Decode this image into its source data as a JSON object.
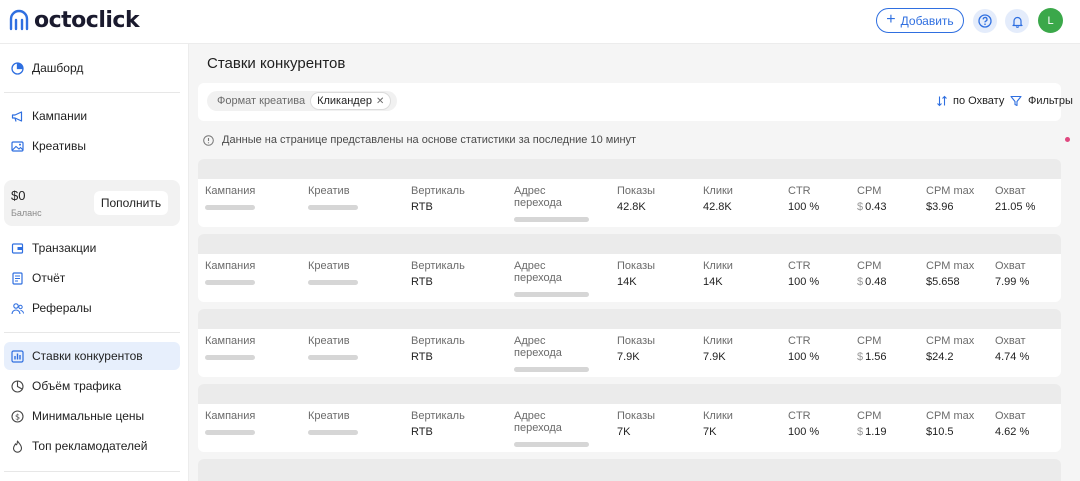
{
  "app": {
    "logo_text": "octoclick"
  },
  "header": {
    "add_label": "Добавить",
    "avatar_letter": "L"
  },
  "sidebar": {
    "dashboard": "Дашборд",
    "campaigns": "Кампании",
    "creatives": "Креативы",
    "balance_amount": "$0",
    "balance_label": "Баланс",
    "topup_label": "Пополнить",
    "transactions": "Транзакции",
    "report": "Отчёт",
    "referrals": "Рефералы",
    "competitor_bids": "Ставки конкурентов",
    "traffic_volume": "Объём трафика",
    "min_prices": "Минимальные цены",
    "top_advertisers": "Топ рекламодателей"
  },
  "main": {
    "title": "Ставки конкурентов",
    "filter_chip_label": "Формат креатива",
    "filter_chip_value": "Кликандер",
    "sort_label": "по Охвату",
    "filters_label": "Фильтры",
    "info_text": "Данные на странице представлены на основе статистики за последние 10 минут"
  },
  "columns": {
    "campaign": "Кампания",
    "creative": "Креатив",
    "vertical": "Вертикаль",
    "url": "Адрес перехода",
    "impressions": "Показы",
    "clicks": "Клики",
    "ctr": "CTR",
    "cpm": "CPM",
    "cpm_max": "CPM max",
    "reach": "Охват"
  },
  "rows": [
    {
      "vertical": "RTB",
      "impressions": "42.8K",
      "clicks": "42.8K",
      "ctr": "100 %",
      "cpm_currency": "$",
      "cpm": "0.43",
      "cpm_max": "$3.96",
      "reach": "21.05 %"
    },
    {
      "vertical": "RTB",
      "impressions": "14K",
      "clicks": "14K",
      "ctr": "100 %",
      "cpm_currency": "$",
      "cpm": "0.48",
      "cpm_max": "$5.658",
      "reach": "7.99 %"
    },
    {
      "vertical": "RTB",
      "impressions": "7.9K",
      "clicks": "7.9K",
      "ctr": "100 %",
      "cpm_currency": "$",
      "cpm": "1.56",
      "cpm_max": "$24.2",
      "reach": "4.74 %"
    },
    {
      "vertical": "RTB",
      "impressions": "7K",
      "clicks": "7K",
      "ctr": "100 %",
      "cpm_currency": "$",
      "cpm": "1.19",
      "cpm_max": "$10.5",
      "reach": "4.62 %"
    }
  ],
  "colors": {
    "accent": "#2f6fe0",
    "avatar": "#3ba84a",
    "active_bg": "#e7effc",
    "filter_dot": "#e0487f"
  }
}
